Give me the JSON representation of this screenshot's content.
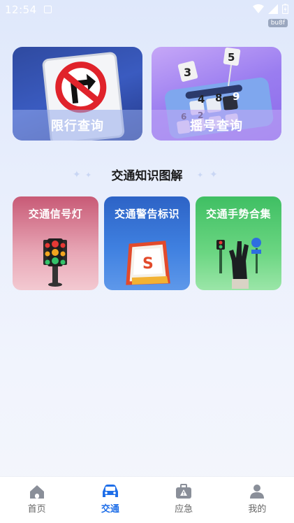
{
  "status": {
    "time": "12:54",
    "build_tag": "bu8f"
  },
  "top_cards": [
    {
      "label": "限行查询",
      "icon": "no-right-turn-sign"
    },
    {
      "label": "摇号查询",
      "icon": "number-keypad"
    }
  ],
  "section": {
    "title": "交通知识图解"
  },
  "mid_cards": [
    {
      "label": "交通信号灯",
      "icon": "traffic-light"
    },
    {
      "label": "交通警告标识",
      "icon": "warning-sign"
    },
    {
      "label": "交通手势合集",
      "icon": "hand-gesture"
    }
  ],
  "art_text": {
    "lottery_numbers": [
      "3",
      "5",
      "4",
      "8",
      "9",
      "6",
      "2"
    ],
    "warning_letter": "S"
  },
  "tabs": [
    {
      "label": "首页",
      "icon": "home-icon",
      "active": false
    },
    {
      "label": "交通",
      "icon": "car-icon",
      "active": true
    },
    {
      "label": "应急",
      "icon": "emergency-kit-icon",
      "active": false
    },
    {
      "label": "我的",
      "icon": "user-icon",
      "active": false
    }
  ],
  "colors": {
    "accent": "#1e6ee8",
    "tab_inactive": "#8a8f99"
  }
}
